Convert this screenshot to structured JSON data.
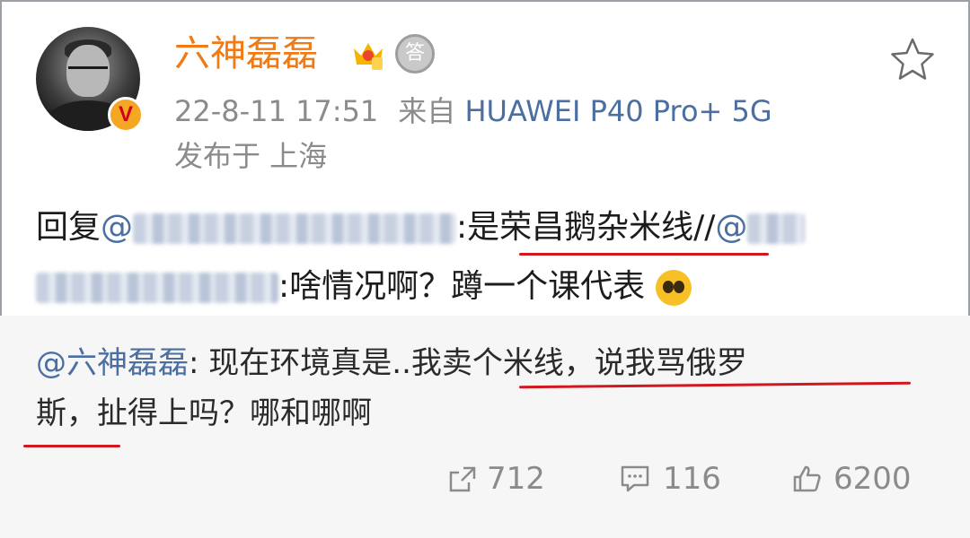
{
  "post": {
    "username": "六神磊磊",
    "avatar_icon": "avatar-photo",
    "verified_badge": "V",
    "medal_label": "答",
    "timestamp": "22-8-11 17:51",
    "source_prefix": "来自",
    "device": "HUAWEI P40 Pro+ 5G",
    "location": "发布于 上海",
    "colors": {
      "username": "#ef7a16",
      "link": "#4a6fa0",
      "meta": "#8b8b8b",
      "underline": "#d0181e"
    }
  },
  "reply": {
    "prefix": "回复",
    "at1": "@",
    "text1": ":是荣昌鹅杂米线//",
    "at2": "@",
    "text2": ":啥情况啊？蹲一个课代表"
  },
  "quoted": {
    "mention": "@六神磊磊",
    "line1": ": 现在环境真是..我卖个米线，说我骂俄罗",
    "line2": "斯，扯得上吗？哪和哪啊"
  },
  "actions": {
    "share_count": "712",
    "comment_count": "116",
    "like_count": "6200"
  }
}
